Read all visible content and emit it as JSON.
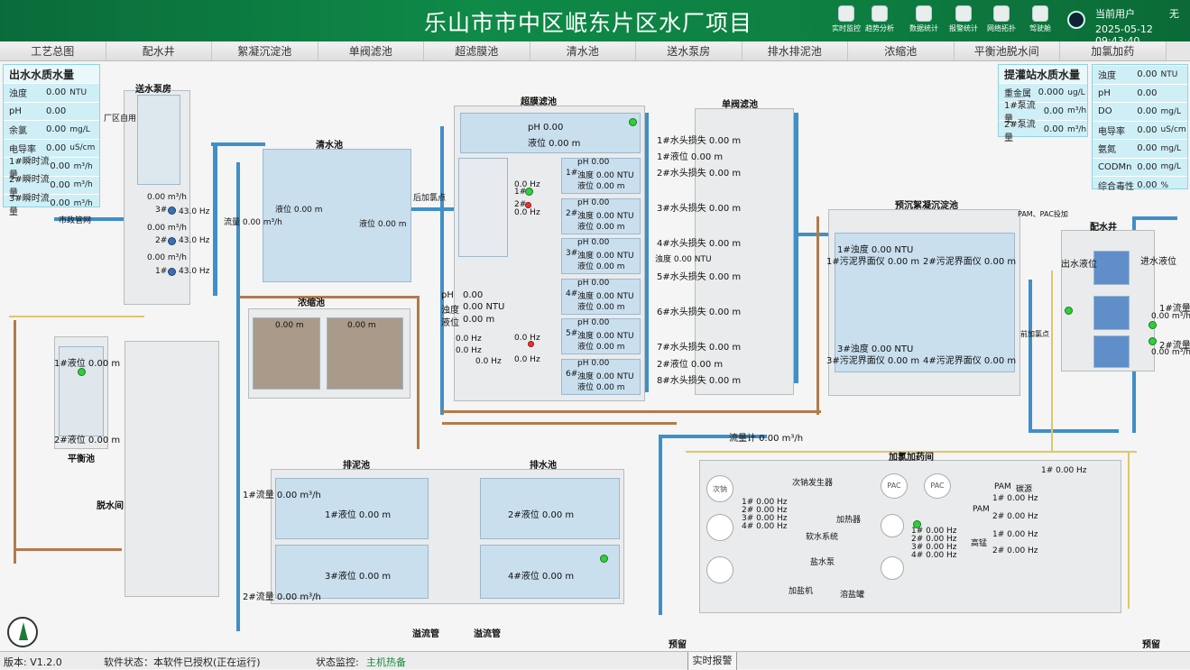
{
  "header": {
    "title": "乐山市市中区岷东片区水厂项目",
    "tools": [
      {
        "label": "实时监控",
        "icon": "monitor-icon"
      },
      {
        "label": "趋势分析",
        "icon": "trend-icon"
      },
      {
        "label": "数据统计",
        "icon": "stats-icon"
      },
      {
        "label": "报警统计",
        "icon": "alarm-icon"
      },
      {
        "label": "网络拓扑",
        "icon": "network-icon"
      },
      {
        "label": "驾驶舱",
        "icon": "cockpit-icon"
      }
    ],
    "user_label": "当前用户",
    "user_value": "无",
    "datetime": "2025-05-12 09:43:40"
  },
  "nav": {
    "tabs": [
      "工艺总图",
      "配水井",
      "絮凝沉淀池",
      "单阀滤池",
      "超滤膜池",
      "清水池",
      "送水泵房",
      "排水排泥池",
      "浓缩池",
      "平衡池脱水间",
      "加氯加药"
    ]
  },
  "left_panel": {
    "title": "出水水质水量",
    "rows": [
      {
        "k": "浊度",
        "v": "0.00",
        "u": "NTU"
      },
      {
        "k": "pH",
        "v": "0.00",
        "u": ""
      },
      {
        "k": "余氯",
        "v": "0.00",
        "u": "mg/L"
      },
      {
        "k": "电导率",
        "v": "0.00",
        "u": "uS/cm"
      },
      {
        "k": "1#瞬时流量",
        "v": "0.00",
        "u": "m³/h"
      },
      {
        "k": "2#瞬时流量",
        "v": "0.00",
        "u": "m³/h"
      },
      {
        "k": "3#瞬时流量",
        "v": "0.00",
        "u": "m³/h"
      }
    ]
  },
  "mid_panel": {
    "title": "提灌站水质水量",
    "rows": [
      {
        "k": "重金属",
        "v": "0.000",
        "u": "ug/L"
      },
      {
        "k": "1#泵流量",
        "v": "0.00",
        "u": "m³/h"
      },
      {
        "k": "2#泵流量",
        "v": "0.00",
        "u": "m³/h"
      }
    ]
  },
  "right_panel": {
    "rows": [
      {
        "k": "浊度",
        "v": "0.00",
        "u": "NTU"
      },
      {
        "k": "pH",
        "v": "0.00",
        "u": ""
      },
      {
        "k": "DO",
        "v": "0.00",
        "u": "mg/L"
      },
      {
        "k": "电导率",
        "v": "0.00",
        "u": "uS/cm"
      },
      {
        "k": "氨氮",
        "v": "0.00",
        "u": "mg/L"
      },
      {
        "k": "CODMn",
        "v": "0.00",
        "u": "mg/L"
      },
      {
        "k": "综合毒性",
        "v": "0.00",
        "u": "%"
      }
    ]
  },
  "labels": {
    "pump_house": "送水泵房",
    "plant_use": "厂区自用",
    "municipal": "市政管网",
    "pump_flow": "0.00 m³/h",
    "p3": "3#",
    "p2": "2#",
    "p1": "1#",
    "hz": "43.0 Hz",
    "clear_tank": "清水池",
    "clear_level": "液位 0.00 m",
    "clear_level2": "液位 0.00 m",
    "clear_flow": "流量 0.00 m³/h",
    "post_chlorine": "后加氯点",
    "thickener": "浓缩池",
    "thick_lv1": "0.00 m",
    "thick_lv2": "0.00 m",
    "uf": "超膜滤池",
    "uf_ph": "pH 0.00",
    "uf_lv": "液位 0.00 m",
    "uf_ph_l": "pH",
    "uf_ph_lv": "0.00",
    "uf_tur_l": "浊度",
    "uf_tur_v": "0.00 NTU",
    "uf_lv_l": "液位",
    "uf_lv_v": "0.00 m",
    "uf_hz": "0.0 Hz",
    "uf_p1": "1#",
    "uf_p2": "2#",
    "uf_cells": [
      {
        "n": "1#",
        "ph": "pH  0.00",
        "tur": "浊度 0.00 NTU",
        "lv": "液位 0.00 m"
      },
      {
        "n": "2#",
        "ph": "pH  0.00",
        "tur": "浊度 0.00 NTU",
        "lv": "液位 0.00 m"
      },
      {
        "n": "3#",
        "ph": "pH  0.00",
        "tur": "浊度 0.00 NTU",
        "lv": "液位 0.00 m"
      },
      {
        "n": "4#",
        "ph": "pH  0.00",
        "tur": "浊度 0.00 NTU",
        "lv": "液位 0.00 m"
      },
      {
        "n": "5#",
        "ph": "pH  0.00",
        "tur": "浊度 0.00 NTU",
        "lv": "液位 0.00 m"
      },
      {
        "n": "6#",
        "ph": "pH  0.00",
        "tur": "浊度 0.00 NTU",
        "lv": "液位 0.00 m"
      }
    ],
    "filter": "单阀滤池",
    "filter_rows": [
      "1#水头损失 0.00 m",
      "1#液位 0.00 m",
      "2#水头损失 0.00 m",
      "3#水头损失 0.00 m",
      "4#水头损失 0.00 m",
      "5#水头损失 0.00 m",
      "6#水头损失 0.00 m",
      "7#水头损失 0.00 m",
      "2#液位 0.00 m",
      "8#水头损失 0.00 m"
    ],
    "filter_tur": "浊度   0.00 NTU",
    "sed": "预沉絮凝沉淀池",
    "sed1": "1#浊度 0.00 NTU",
    "sed1m": "1#污泥界面仪 0.00 m",
    "sed2m": "2#污泥界面仪 0.00 m",
    "sed3": "3#浊度 0.00 NTU",
    "sed3m": "3#污泥界面仪 0.00 m",
    "sed4m": "4#污泥界面仪 0.00 m",
    "pam_pac": "PAM、PAC投加",
    "pre_chlorine": "前加氯点",
    "well": "配水井",
    "well_out": "出水液位",
    "well_in": "进水液位",
    "well_f1": "1#流量",
    "well_f1v": "0.00 m³/h",
    "well_f2": "2#流量",
    "well_f2v": "0.00 m³/h",
    "flowmeter": "流量计 0.00 m³/h",
    "balance": "平衡池",
    "bal1": "1#液位 0.00 m",
    "bal2": "2#液位 0.00 m",
    "dewater": "脱水间",
    "mud": "排泥池",
    "mud1": "1#液位 0.00 m",
    "mud3": "3#液位 0.00 m",
    "mud_f1": "1#流量 0.00 m³/h",
    "mud_f2": "2#流量 0.00 m³/h",
    "drain": "排水池",
    "drain2": "2#液位 0.00 m",
    "drain4": "4#液位 0.00 m",
    "overflow1": "溢流管",
    "overflow2": "溢流管",
    "dosing": "加氯加药间",
    "naclo": "次钠",
    "naclo_gen": "次钠发生器",
    "soft": "软水系统",
    "heater": "加热器",
    "brine": "盐水泵",
    "salt": "加盐机",
    "salt_tank": "溶盐罐",
    "hz_a": "1#  0.00 Hz",
    "hz_b": "2#  0.00 Hz",
    "hz_c": "3#  0.00 Hz",
    "hz_d": "4#  0.00 Hz",
    "pac": "PAC",
    "pam": "PAM",
    "carbon": "碳源",
    "high": "高锰",
    "reserve1": "预留",
    "reserve2": "预留"
  },
  "footer": {
    "version": "版本: V1.2.0",
    "status": "软件状态：本软件已授权(正在运行)",
    "monitor_label": "状态监控:",
    "monitor_value": "主机热备",
    "alarm": "实时报警"
  },
  "colors": {
    "header": "#0f8a47",
    "panel": "#cfeff6",
    "pipe_water": "#3f8fc9",
    "pipe_sludge": "#b37a4c",
    "pipe_chem": "#e0c66a",
    "status_ok": "#2fcf3a"
  }
}
